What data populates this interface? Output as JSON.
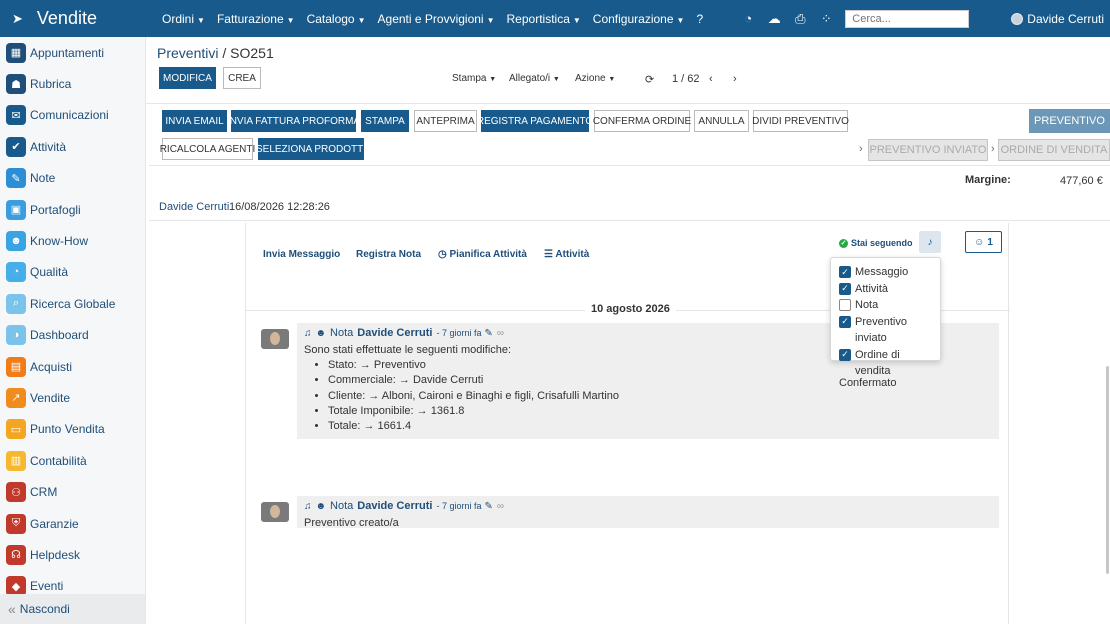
{
  "app": {
    "title": "Vendite",
    "logo_icon": "rocket-icon"
  },
  "topnav": {
    "menu": [
      {
        "label": "Ordini"
      },
      {
        "label": "Fatturazione"
      },
      {
        "label": "Catalogo"
      },
      {
        "label": "Agenti e Provvigioni"
      },
      {
        "label": "Reportistica"
      },
      {
        "label": "Configurazione"
      }
    ],
    "help": "?",
    "search_placeholder": "Cerca...",
    "user_name": "Davide Cerruti"
  },
  "sidebar": {
    "items": [
      {
        "label": "Appuntamenti",
        "icon": "calendar-icon",
        "color": "#1f4e79",
        "glyph": "▦"
      },
      {
        "label": "Rubrica",
        "icon": "contacts-icon",
        "color": "#1f4e79",
        "glyph": "☗"
      },
      {
        "label": "Comunicazioni",
        "icon": "chat-icon",
        "color": "#185a8c",
        "glyph": "✉"
      },
      {
        "label": "Attività",
        "icon": "check-icon",
        "color": "#185a8c",
        "glyph": "✔"
      },
      {
        "label": "Note",
        "icon": "note-icon",
        "color": "#2c8ed6",
        "glyph": "✎"
      },
      {
        "label": "Portafogli",
        "icon": "lock-icon",
        "color": "#3a9de0",
        "glyph": "▣"
      },
      {
        "label": "Know-How",
        "icon": "brain-icon",
        "color": "#3aa3e3",
        "glyph": "☻"
      },
      {
        "label": "Qualità",
        "icon": "gauge-icon",
        "color": "#46aee8",
        "glyph": "◔"
      },
      {
        "label": "Ricerca Globale",
        "icon": "search-icon",
        "color": "#7cc3ec",
        "glyph": "⌕"
      },
      {
        "label": "Dashboard",
        "icon": "dashboard-icon",
        "color": "#7cc3ec",
        "glyph": "◑"
      },
      {
        "label": "Acquisti",
        "icon": "purchase-icon",
        "color": "#f07d1a",
        "glyph": "▤"
      },
      {
        "label": "Vendite",
        "icon": "chart-icon",
        "color": "#f08b1d",
        "glyph": "↗"
      },
      {
        "label": "Punto Vendita",
        "icon": "pos-icon",
        "color": "#f4a623",
        "glyph": "▭"
      },
      {
        "label": "Contabilità",
        "icon": "ledger-icon",
        "color": "#f5b82e",
        "glyph": "▥"
      },
      {
        "label": "CRM",
        "icon": "handshake-icon",
        "color": "#c0392b",
        "glyph": "⚇"
      },
      {
        "label": "Garanzie",
        "icon": "shield-icon",
        "color": "#c0392b",
        "glyph": "⛨"
      },
      {
        "label": "Helpdesk",
        "icon": "headset-icon",
        "color": "#c0392b",
        "glyph": "☊"
      },
      {
        "label": "Eventi",
        "icon": "ticket-icon",
        "color": "#c0392b",
        "glyph": "◆"
      }
    ],
    "collapse_label": "Nascondi"
  },
  "breadcrumb": {
    "parent": "Preventivi",
    "separator": "/",
    "current": "SO251"
  },
  "toolbar": {
    "edit": "MODIFICA",
    "create": "CREA",
    "print": "Stampa",
    "attachments": "Allegato/i",
    "actions": "Azione",
    "pager": "1 / 62"
  },
  "action_buttons": {
    "send_email": "INVIA EMAIL",
    "send_proforma": "INVIA FATTURA PROFORMA",
    "print": "STAMPA",
    "preview": "ANTEPRIMA",
    "register_payment": "REGISTRA PAGAMENTO",
    "confirm_order": "CONFERMA ORDINE",
    "cancel": "ANNULLA",
    "split_quote": "DIVIDI PREVENTIVO",
    "recalc_agents": "RICALCOLA AGENTI",
    "select_products": "SELEZIONA PRODOTTI"
  },
  "status": {
    "current": "PREVENTIVO",
    "sent": "PREVENTIVO INVIATO",
    "sale_order": "ORDINE DI VENDITA"
  },
  "summary": {
    "margin_label": "Margine:",
    "margin_value": "477,60 €"
  },
  "record_meta": {
    "user": "Davide Cerruti",
    "datetime": "16/08/2026 12:28:26"
  },
  "chatter": {
    "send_message": "Invia Messaggio",
    "log_note": "Registra Nota",
    "schedule_activity": "Pianifica Attività",
    "activities": "Attività",
    "following": "Stai seguendo",
    "followers_count": "1",
    "date_separator": "10 agosto 2026",
    "subscriptions": [
      {
        "label": "Messaggio",
        "checked": true
      },
      {
        "label": "Attività",
        "checked": true
      },
      {
        "label": "Nota",
        "checked": false
      },
      {
        "label": "Preventivo inviato",
        "checked": true
      },
      {
        "label": "Ordine di vendita",
        "checked": true
      }
    ],
    "subscription_tail": "Confermato",
    "messages": [
      {
        "type": "Nota",
        "author": "Davide Cerruti",
        "ago": "- 7 giorni fa",
        "intro": "Sono stati effettuate le seguenti modifiche:",
        "changes": [
          "Stato: → Preventivo",
          "Commerciale: → Davide Cerruti",
          "Cliente: → Alboni, Caironi e Binaghi e figli, Crisafulli Martino",
          "Totale Imponibile: → 1361.8",
          "Totale: → 1661.4"
        ]
      },
      {
        "type": "Nota",
        "author": "Davide Cerruti",
        "ago": "- 7 giorni fa",
        "intro": "Preventivo creato/a",
        "changes": []
      }
    ]
  }
}
